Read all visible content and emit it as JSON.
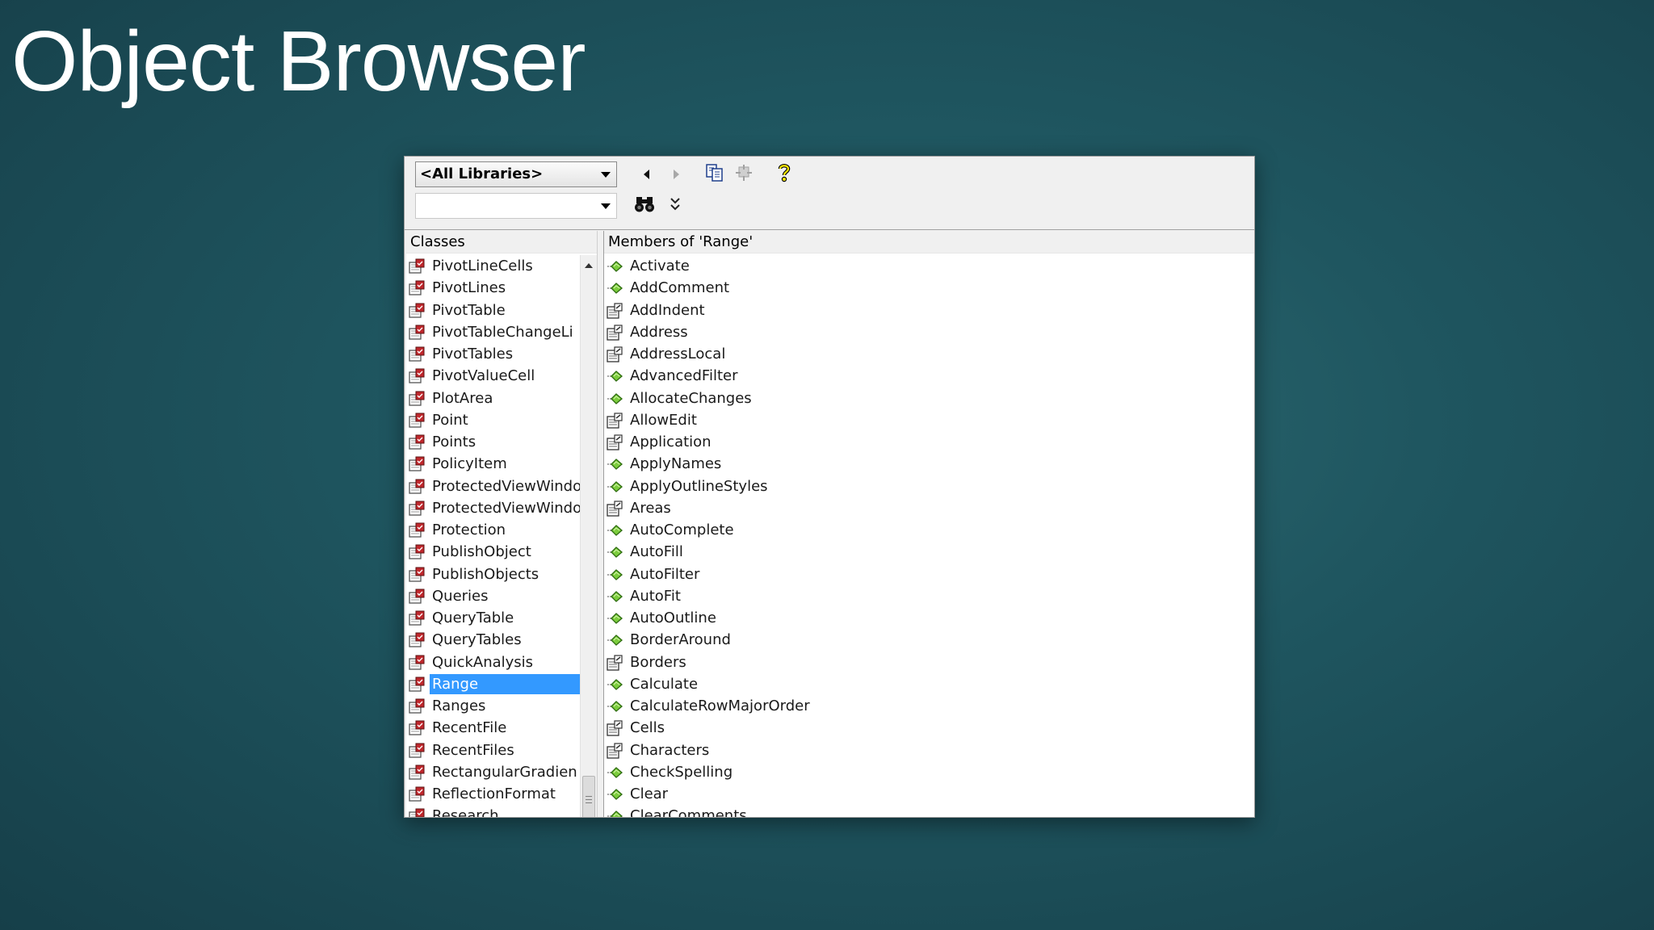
{
  "slide": {
    "title": "Object Browser"
  },
  "toolbar": {
    "library_dropdown": "<All Libraries>",
    "search_value": ""
  },
  "classes": {
    "header": "Classes",
    "selected": "Range",
    "items": [
      "PivotLineCells",
      "PivotLines",
      "PivotTable",
      "PivotTableChangeLi",
      "PivotTables",
      "PivotValueCell",
      "PlotArea",
      "Point",
      "Points",
      "PolicyItem",
      "ProtectedViewWindo",
      "ProtectedViewWindo",
      "Protection",
      "PublishObject",
      "PublishObjects",
      "Queries",
      "QueryTable",
      "QueryTables",
      "QuickAnalysis",
      "Range",
      "Ranges",
      "RecentFile",
      "RecentFiles",
      "RectangularGradien",
      "ReflectionFormat",
      "Research"
    ]
  },
  "members": {
    "header": "Members of 'Range'",
    "items": [
      {
        "name": "Activate",
        "kind": "method"
      },
      {
        "name": "AddComment",
        "kind": "method"
      },
      {
        "name": "AddIndent",
        "kind": "property"
      },
      {
        "name": "Address",
        "kind": "property"
      },
      {
        "name": "AddressLocal",
        "kind": "property"
      },
      {
        "name": "AdvancedFilter",
        "kind": "method"
      },
      {
        "name": "AllocateChanges",
        "kind": "method"
      },
      {
        "name": "AllowEdit",
        "kind": "property"
      },
      {
        "name": "Application",
        "kind": "property"
      },
      {
        "name": "ApplyNames",
        "kind": "method"
      },
      {
        "name": "ApplyOutlineStyles",
        "kind": "method"
      },
      {
        "name": "Areas",
        "kind": "property"
      },
      {
        "name": "AutoComplete",
        "kind": "method"
      },
      {
        "name": "AutoFill",
        "kind": "method"
      },
      {
        "name": "AutoFilter",
        "kind": "method"
      },
      {
        "name": "AutoFit",
        "kind": "method"
      },
      {
        "name": "AutoOutline",
        "kind": "method"
      },
      {
        "name": "BorderAround",
        "kind": "method"
      },
      {
        "name": "Borders",
        "kind": "property"
      },
      {
        "name": "Calculate",
        "kind": "method"
      },
      {
        "name": "CalculateRowMajorOrder",
        "kind": "method"
      },
      {
        "name": "Cells",
        "kind": "property"
      },
      {
        "name": "Characters",
        "kind": "property"
      },
      {
        "name": "CheckSpelling",
        "kind": "method"
      },
      {
        "name": "Clear",
        "kind": "method"
      },
      {
        "name": "ClearComments",
        "kind": "method"
      }
    ]
  }
}
